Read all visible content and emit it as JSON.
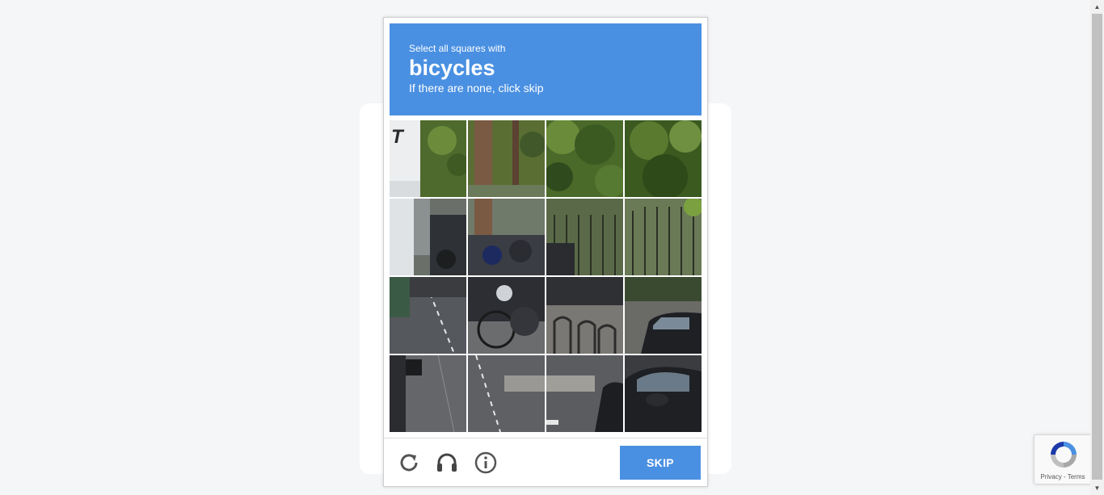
{
  "challenge": {
    "instruction_prefix": "Select all squares with",
    "keyword": "bicycles",
    "instruction_suffix": "If there are none, click skip",
    "tiles": [
      {
        "row": 1,
        "col": 1,
        "selected": false
      },
      {
        "row": 1,
        "col": 2,
        "selected": false
      },
      {
        "row": 1,
        "col": 3,
        "selected": false
      },
      {
        "row": 1,
        "col": 4,
        "selected": false
      },
      {
        "row": 2,
        "col": 1,
        "selected": false
      },
      {
        "row": 2,
        "col": 2,
        "selected": false
      },
      {
        "row": 2,
        "col": 3,
        "selected": false
      },
      {
        "row": 2,
        "col": 4,
        "selected": false
      },
      {
        "row": 3,
        "col": 1,
        "selected": false
      },
      {
        "row": 3,
        "col": 2,
        "selected": false
      },
      {
        "row": 3,
        "col": 3,
        "selected": false
      },
      {
        "row": 3,
        "col": 4,
        "selected": false
      },
      {
        "row": 4,
        "col": 1,
        "selected": false
      },
      {
        "row": 4,
        "col": 2,
        "selected": false
      },
      {
        "row": 4,
        "col": 3,
        "selected": false
      },
      {
        "row": 4,
        "col": 4,
        "selected": false
      }
    ],
    "footer": {
      "icons": [
        "reload-icon",
        "headphones-icon",
        "info-icon"
      ],
      "skip_label": "SKIP"
    }
  },
  "badge": {
    "links": "Privacy - Terms"
  },
  "colors": {
    "accent": "#4a90e2",
    "page_background": "#f5f6f8"
  }
}
